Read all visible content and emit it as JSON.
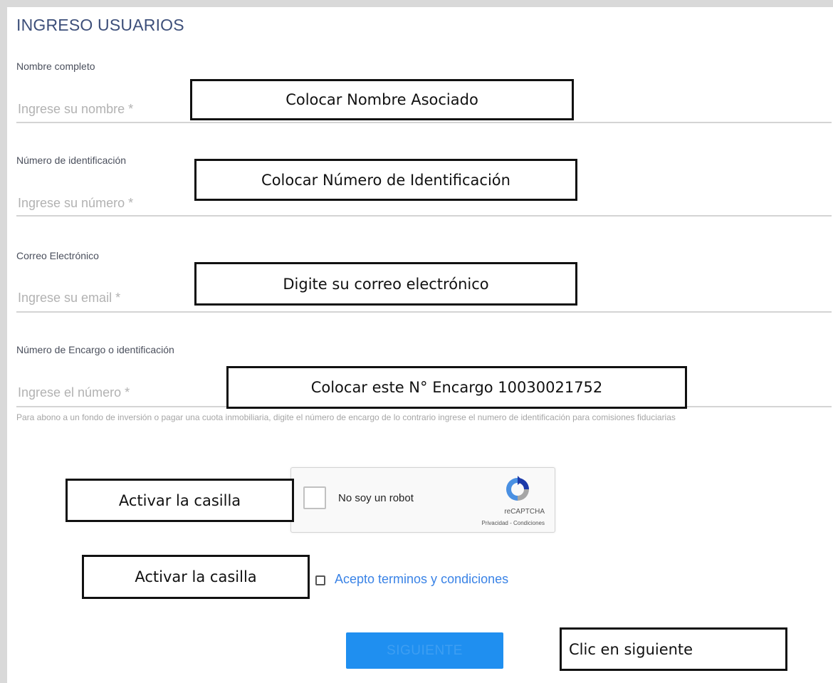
{
  "form": {
    "title": "INGRESO USUARIOS",
    "fields": [
      {
        "label": "Nombre completo",
        "placeholder": "Ingrese su nombre *"
      },
      {
        "label": "Número de identificación",
        "placeholder": "Ingrese su número *"
      },
      {
        "label": "Correo Electrónico",
        "placeholder": "Ingrese su email *"
      },
      {
        "label": "Número de Encargo o identificación",
        "placeholder": "Ingrese el número *"
      }
    ],
    "hint": "Para abono a un fondo de inversión o pagar una cuota inmobiliaria, digite el número de encargo de lo contrario ingrese el numero de identificación para comisiones fiduciarias",
    "captcha": {
      "label": "No soy un robot",
      "brand": "reCAPTCHA",
      "links": "Privacidad - Condiciones"
    },
    "terms_label": "Acepto terminos y condiciones",
    "submit_label": "SIGUIENTE"
  },
  "annotations": {
    "name": "Colocar Nombre Asociado",
    "id_number": "Colocar Número de Identificación",
    "email": "Digite su correo electrónico",
    "encargo": "Colocar este N° Encargo 10030021752",
    "captcha": "Activar la casilla",
    "terms": "Activar la casilla",
    "submit": "Clic en siguiente"
  },
  "colors": {
    "title": "#3d4f7a",
    "link": "#3a83e6",
    "button": "#1f8ff0",
    "placeholder": "#b2b2b2"
  }
}
